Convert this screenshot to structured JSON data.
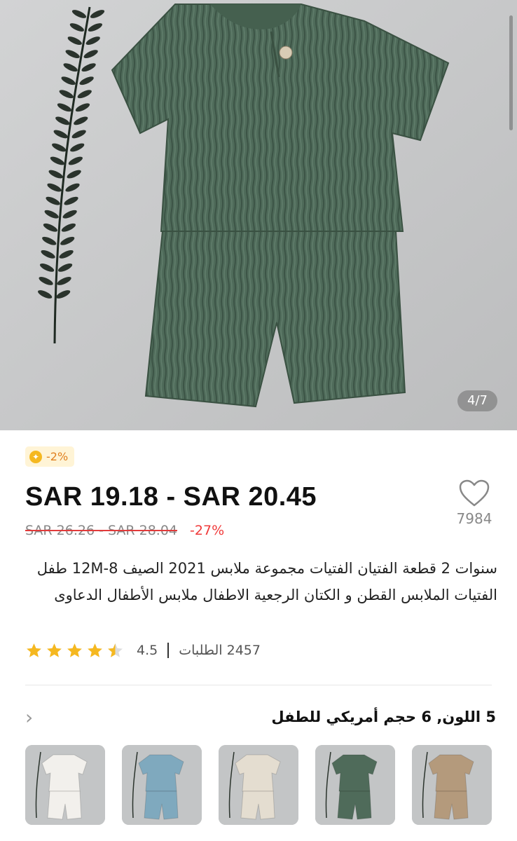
{
  "gallery": {
    "counter": "4/7",
    "image": "green-muslin-kids-set"
  },
  "coupon": {
    "icon": "coupon-icon",
    "text": "-2%"
  },
  "price": {
    "range": "SAR 19.18 - SAR 20.45",
    "original": "SAR 26.26 - SAR 28.04",
    "discount": "-27%"
  },
  "wishlist": {
    "icon": "heart-icon",
    "count": "7984"
  },
  "product": {
    "title": "سنوات 2 قطعة الفتيان الفتيات مجموعة ملابس 2021 الصيف 8-12M طفل الفتيات الملابس القطن و الكتان الرجعية الاطفال ملابس الأطفال الدعاوى"
  },
  "rating": {
    "value": "4.5",
    "stars": 4.5,
    "orders": "2457 الطلبات"
  },
  "variant": {
    "label": "5 اللون, 6 حجم أمريكي للطفل",
    "chevron": "chevron-right-icon"
  },
  "swatches": [
    {
      "name": "white",
      "color": "#f2f0ec"
    },
    {
      "name": "blue",
      "color": "#7fa9be"
    },
    {
      "name": "cream",
      "color": "#e4ddd0"
    },
    {
      "name": "green",
      "color": "#4f6b5a"
    },
    {
      "name": "khaki",
      "color": "#b49a7c"
    }
  ],
  "colors": {
    "accent_red": "#f03a3a",
    "coupon_bg": "#fff4d6",
    "coupon_text": "#e0801f",
    "star": "#f5b820"
  }
}
